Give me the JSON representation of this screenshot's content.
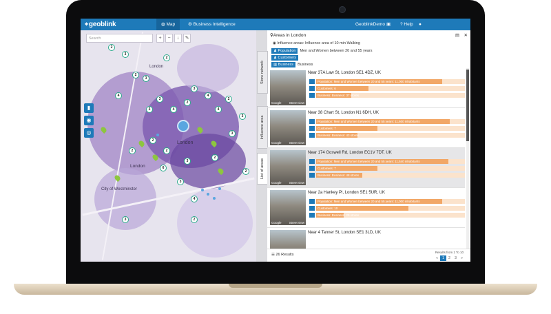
{
  "app": {
    "logo": "geoblink"
  },
  "nav": {
    "map": "Map",
    "business": "Business Intelligence",
    "user": "GeoblinkDemo",
    "help": "Help"
  },
  "map": {
    "search_placeholder": "Search",
    "labels": {
      "london": "London",
      "london2": "London",
      "london3": "London",
      "westminster": "City of Westminster"
    },
    "markers": [
      "2",
      "3",
      "2",
      "3",
      "2",
      "4",
      "3",
      "3",
      "4",
      "2",
      "3",
      "4",
      "4",
      "2",
      "3",
      "3",
      "2",
      "2",
      "2",
      "3",
      "2",
      "2",
      "6",
      "3",
      "4",
      "3",
      "2"
    ]
  },
  "panel": {
    "tabs": {
      "store": "Store network",
      "influence": "Influence area",
      "list": "List of areas"
    },
    "title": "Areas in London",
    "influence": "Influence areas:  Influence area of 10 min Walking",
    "filters": [
      {
        "tag": "Population",
        "value": "Men and Women between 20 and 55 years"
      },
      {
        "tag": "Customers",
        "value": ""
      },
      {
        "tag": "Business",
        "value": "Business"
      }
    ],
    "results": [
      {
        "address": "Near 37A Law St, London SE1 4DZ, UK",
        "bars": [
          {
            "text": "Population: Men and Women between 20 and 55 years: 11,000 inhabitants",
            "pct": 82
          },
          {
            "text": "Customers: 6",
            "pct": 34
          },
          {
            "text": "Business: Business: 37 stores",
            "pct": 23
          }
        ]
      },
      {
        "address": "Near 38 Chart St, London N1 6DH, UK",
        "bars": [
          {
            "text": "Population: Men and Women between 20 and 55 years: 11,600 inhabitants",
            "pct": 87
          },
          {
            "text": "Customers: 7",
            "pct": 40
          },
          {
            "text": "Business: Business: 43 stores",
            "pct": 27
          }
        ]
      },
      {
        "address": "Near 174 Goswell Rd, London EC1V 7DT, UK",
        "bars": [
          {
            "text": "Population: Men and Women between 20 and 55 years: 11,540 inhabitants",
            "pct": 86
          },
          {
            "text": "Customers: 7",
            "pct": 40
          },
          {
            "text": "Business: Business: 48 stores",
            "pct": 30
          }
        ]
      },
      {
        "address": "Near 2a Hankey Pl, London SE1 5UR, UK",
        "bars": [
          {
            "text": "Population: Men and Women between 20 and 55 years: 11,000 inhabitants",
            "pct": 82
          },
          {
            "text": "Customers: 10",
            "pct": 60
          },
          {
            "text": "Business: Business: 29 stores",
            "pct": 18
          }
        ]
      },
      {
        "address": "Near 4 Tanner St, London SE1 3LD, UK",
        "bars": []
      }
    ],
    "footer": {
      "count": "26 Results",
      "range": "Results from 1 To 10",
      "pages": [
        "«",
        "1",
        "2",
        "3",
        "»"
      ]
    }
  },
  "colors": {
    "accent": "#1e7ab9",
    "bar_fill": "#f2a766",
    "bar_track": "#fbe3cc"
  }
}
